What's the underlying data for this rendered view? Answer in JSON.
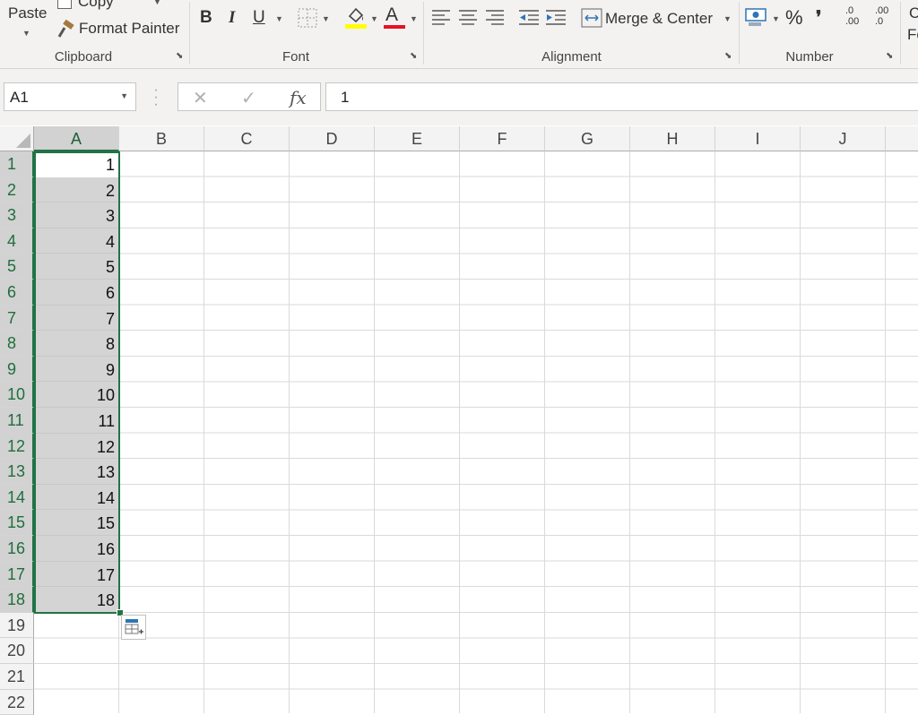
{
  "ribbon": {
    "clipboard": {
      "paste_label": "Paste",
      "copy_label": "Copy",
      "format_painter_label": "Format Painter",
      "group_label": "Clipboard"
    },
    "font": {
      "bold": "B",
      "italic": "I",
      "underline": "U",
      "font_color_letter": "A",
      "group_label": "Font",
      "highlight_color": "#ffff00",
      "font_color": "#e81123"
    },
    "alignment": {
      "merge_center_label": "Merge & Center",
      "group_label": "Alignment"
    },
    "number": {
      "percent": "%",
      "comma": "❜",
      "inc_decimal": ".0 .00",
      "dec_decimal": ".00 .0",
      "group_label": "Number"
    },
    "next_group_partial": {
      "line1": "C",
      "line2": "Fo"
    }
  },
  "formula_bar": {
    "name_box_value": "A1",
    "cancel_symbol": "✕",
    "enter_symbol": "✓",
    "fx_label": "fx",
    "formula_value": "1"
  },
  "grid": {
    "columns": [
      "A",
      "B",
      "C",
      "D",
      "E",
      "F",
      "G",
      "H",
      "I",
      "J"
    ],
    "rows": [
      "1",
      "2",
      "3",
      "4",
      "5",
      "6",
      "7",
      "8",
      "9",
      "10",
      "11",
      "12",
      "13",
      "14",
      "15",
      "16",
      "17",
      "18",
      "19",
      "20",
      "21",
      "22"
    ],
    "column_a_values": [
      "1",
      "2",
      "3",
      "4",
      "5",
      "6",
      "7",
      "8",
      "9",
      "10",
      "11",
      "12",
      "13",
      "14",
      "15",
      "16",
      "17",
      "18"
    ],
    "selected_column": "A",
    "selection_range": "A1:A18",
    "accent_color": "#217346"
  }
}
